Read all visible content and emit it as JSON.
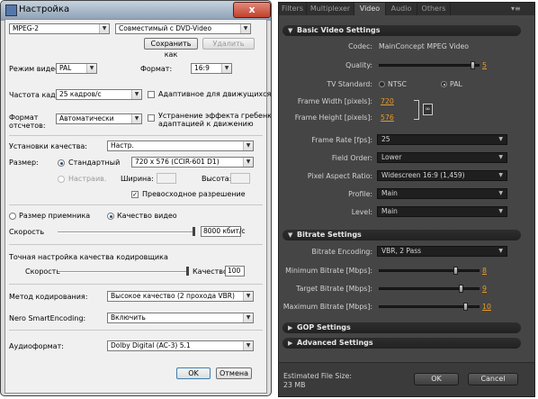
{
  "dialog": {
    "title": "Настройка",
    "profile_format": "MPEG-2",
    "profile_preset": "Совместимый с DVD-Video",
    "save_as": "Сохранить как",
    "delete": "Удалить",
    "video_mode_label": "Режим видео:",
    "video_mode_value": "PAL",
    "format_label": "Формат:",
    "format_value": "16:9",
    "frame_rate_label": "Частота кадров:",
    "frame_rate_value": "25 кадров/с",
    "adaptive_label": "Адаптивное для движущихся с",
    "scan_format_label_1": "Формат",
    "scan_format_label_2": "отсчетов:",
    "scan_format_value": "Автоматически",
    "deinterlace_label_1": "Устранение эффекта гребенки с",
    "deinterlace_label_2": "адаптацией к движению",
    "quality_settings_label": "Установки качества:",
    "quality_settings_value": "Настр.",
    "size_label": "Размер:",
    "standard_label": "Стандартный",
    "standard_value": "720 x 576 (CCIR-601 D1)",
    "custom_label": "Настраив.",
    "width_label": "Ширина:",
    "height_label": "Высота:",
    "superior_res_label": "Превосходное разрешение",
    "check_mark": "✓",
    "receiver_size_label": "Размер приемника",
    "video_quality_label": "Качество видео",
    "speed_label": "Скорость",
    "bitrate_value": "8000 кбит/с",
    "encoder_fine_label": "Точная настройка качества кодировщика",
    "encoder_speed_label": "Скорость",
    "encoder_quality_label": "Качество",
    "encoder_quality_value": "100",
    "encoding_method_label": "Метод кодирования:",
    "encoding_method_value": "Высокое качество (2 прохода VBR)",
    "smart_encoding_label": "Nero SmartEncoding:",
    "smart_encoding_value": "Включить",
    "audio_format_label": "Аудиоформат:",
    "audio_format_value": "Dolby Digital (AC-3) 5.1",
    "ok": "OK",
    "cancel": "Отмена",
    "close_glyph": "x"
  },
  "panel": {
    "tabs": [
      "Filters",
      "Multiplexer",
      "Video",
      "Audio",
      "Others"
    ],
    "active_tab": "Video",
    "basic_title": "Basic Video Settings",
    "codec_label": "Codec:",
    "codec_value": "MainConcept MPEG Video",
    "quality_label": "Quality:",
    "quality_value": "5",
    "quality_level": 0.95,
    "tv_standard_label": "TV Standard:",
    "ntsc_label": "NTSC",
    "pal_label": "PAL",
    "frame_width_label": "Frame Width [pixels]:",
    "frame_width_value": "720",
    "frame_height_label": "Frame Height [pixels]:",
    "frame_height_value": "576",
    "frame_rate_label": "Frame Rate [fps]:",
    "frame_rate_value": "25",
    "field_order_label": "Field Order:",
    "field_order_value": "Lower",
    "par_label": "Pixel Aspect Ratio:",
    "par_value": "Widescreen 16:9 (1,459)",
    "profile_label": "Profile:",
    "profile_value": "Main",
    "level_label": "Level:",
    "level_value": "Main",
    "bitrate_title": "Bitrate Settings",
    "bitrate_encoding_label": "Bitrate Encoding:",
    "bitrate_encoding_value": "VBR, 2 Pass",
    "min_bitrate_label": "Minimum Bitrate [Mbps]:",
    "min_bitrate_value": "8",
    "min_bitrate_level": 0.78,
    "target_bitrate_label": "Target Bitrate [Mbps]:",
    "target_bitrate_value": "9",
    "target_bitrate_level": 0.83,
    "max_bitrate_label": "Maximum Bitrate [Mbps]:",
    "max_bitrate_value": "10",
    "max_bitrate_level": 0.88,
    "gop_title": "GOP Settings",
    "advanced_title": "Advanced Settings",
    "est_size_label": "Estimated File Size:",
    "est_size_value": "23 MB",
    "ok": "OK",
    "cancel": "Cancel"
  }
}
